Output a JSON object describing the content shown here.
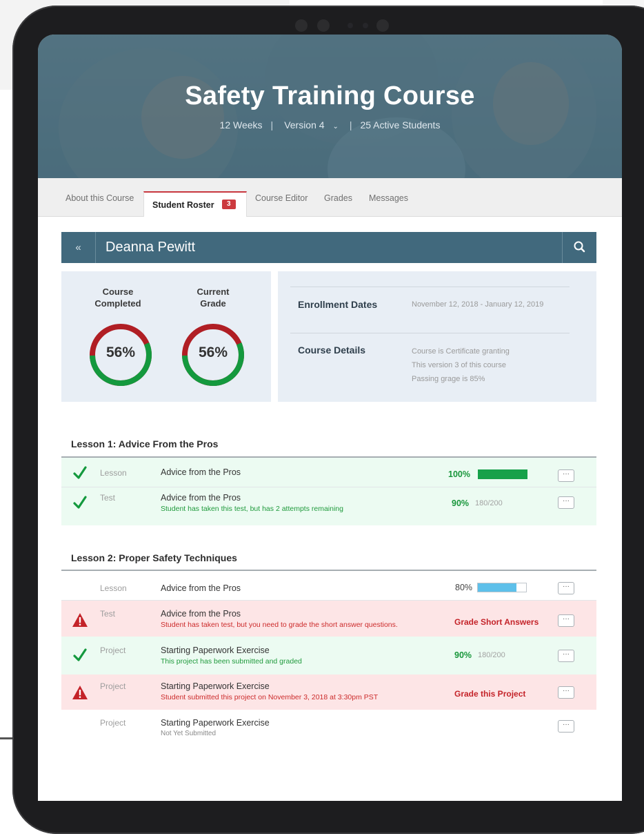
{
  "course": {
    "title": "Safety Training Course",
    "duration": "12 Weeks",
    "version": "Version 4",
    "active_students": "25 Active Students"
  },
  "tabs": {
    "about": "About this Course",
    "roster": "Student Roster",
    "roster_badge": "3",
    "editor": "Course Editor",
    "grades": "Grades",
    "messages": "Messages"
  },
  "student": {
    "name": "Deanna Pewitt"
  },
  "stats": {
    "completed_label_line1": "Course",
    "completed_label_line2": "Completed",
    "completed_value": "56%",
    "completed_fraction": 0.56,
    "grade_label_line1": "Current",
    "grade_label_line2": "Grade",
    "grade_value": "56%",
    "grade_fraction": 0.56
  },
  "info": {
    "enrollment_label": "Enrollment Dates",
    "enrollment_value": "November 12, 2018 - January 12, 2019",
    "details_label": "Course Details",
    "details_line1": "Course is Certificate granting",
    "details_line2": "This version 3 of this course",
    "details_line3": "Passing grage is 85%"
  },
  "lesson1": {
    "heading": "Lesson 1: Advice From the Pros",
    "rows": [
      {
        "type": "Lesson",
        "title": "Advice from the Pros",
        "percent": "100%",
        "progress": 1.0
      },
      {
        "type": "Test",
        "title": "Advice from the Pros",
        "subtitle": "Student has taken this test, but has 2 attempts remaining",
        "percent": "90%",
        "score": "180/200"
      }
    ]
  },
  "lesson2": {
    "heading": "Lesson 2: Proper Safety Techniques",
    "rows": [
      {
        "type": "Lesson",
        "title": "Advice from the Pros",
        "percent": "80%",
        "progress": 0.8
      },
      {
        "type": "Test",
        "title": "Advice from the Pros",
        "subtitle": "Student has taken test, but you need to grade the short answer questions.",
        "action": "Grade Short Answers"
      },
      {
        "type": "Project",
        "title": "Starting Paperwork Exercise",
        "subtitle": "This project has been submitted and graded",
        "percent": "90%",
        "score": "180/200"
      },
      {
        "type": "Project",
        "title": "Starting Paperwork Exercise",
        "subtitle": "Student submitted this project on November 3, 2018 at 3:30pm PST",
        "action": "Grade this Project"
      },
      {
        "type": "Project",
        "title": "Starting Paperwork Exercise",
        "subtitle": "Not Yet Submitted"
      }
    ]
  },
  "icons": {
    "back": "double-chevron-left-icon",
    "search": "search-icon",
    "complete": "checkmark-icon",
    "warning": "warning-icon",
    "more": "ellipsis-icon"
  },
  "colors": {
    "header": "#41697d",
    "success": "#18963b",
    "danger": "#c42329",
    "progress_blue": "#5ec0ea",
    "badge": "#cc3a3f"
  },
  "more_label": "···",
  "back_label": "«"
}
